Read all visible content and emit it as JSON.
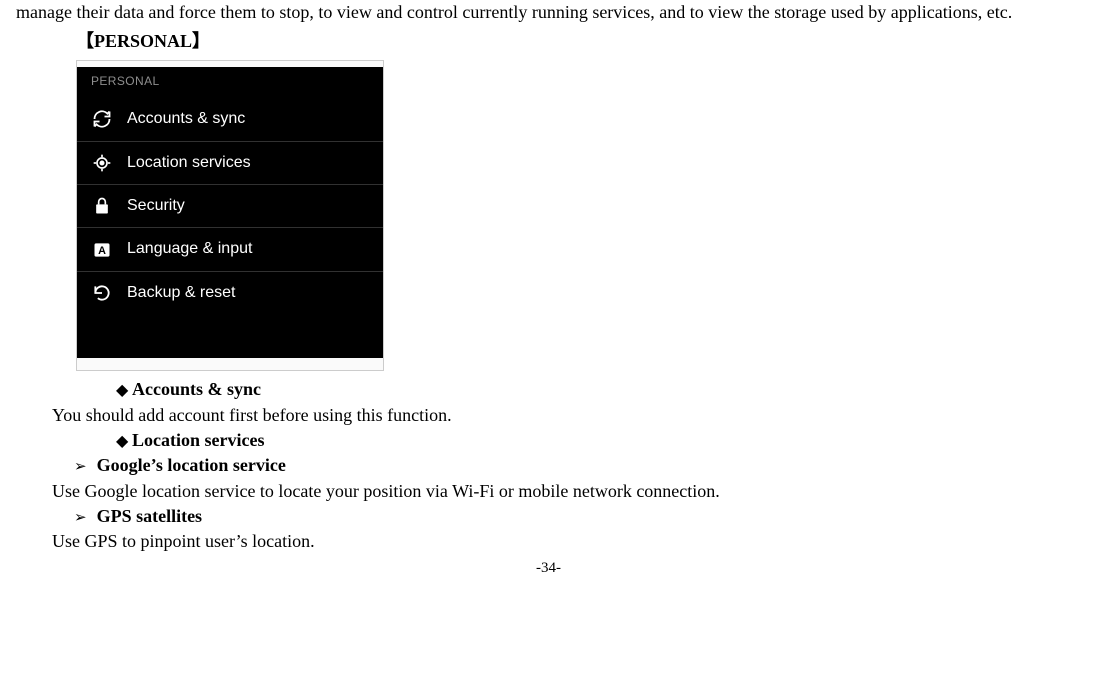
{
  "top_text": "manage their data and force them to stop, to view and control currently running services, and to view the storage used by applications, etc.",
  "section_header": "【PERSONAL】",
  "screenshot": {
    "header": "PERSONAL",
    "items": [
      {
        "name": "accounts-sync",
        "label": "Accounts & sync"
      },
      {
        "name": "location-services",
        "label": "Location services"
      },
      {
        "name": "security",
        "label": "Security"
      },
      {
        "name": "language-input",
        "label": "Language & input"
      },
      {
        "name": "backup-reset",
        "label": "Backup & reset"
      }
    ]
  },
  "bullets": {
    "accounts_sync": "Accounts & sync",
    "accounts_sync_body": "You should add account first before using this function.",
    "location_services": "Location services",
    "google_location": "Google’s location service",
    "google_location_body": "Use Google location service to locate your position via Wi-Fi or mobile network connection.",
    "gps": "GPS satellites",
    "gps_body": "Use GPS to pinpoint user’s location."
  },
  "page_number": "-34-"
}
